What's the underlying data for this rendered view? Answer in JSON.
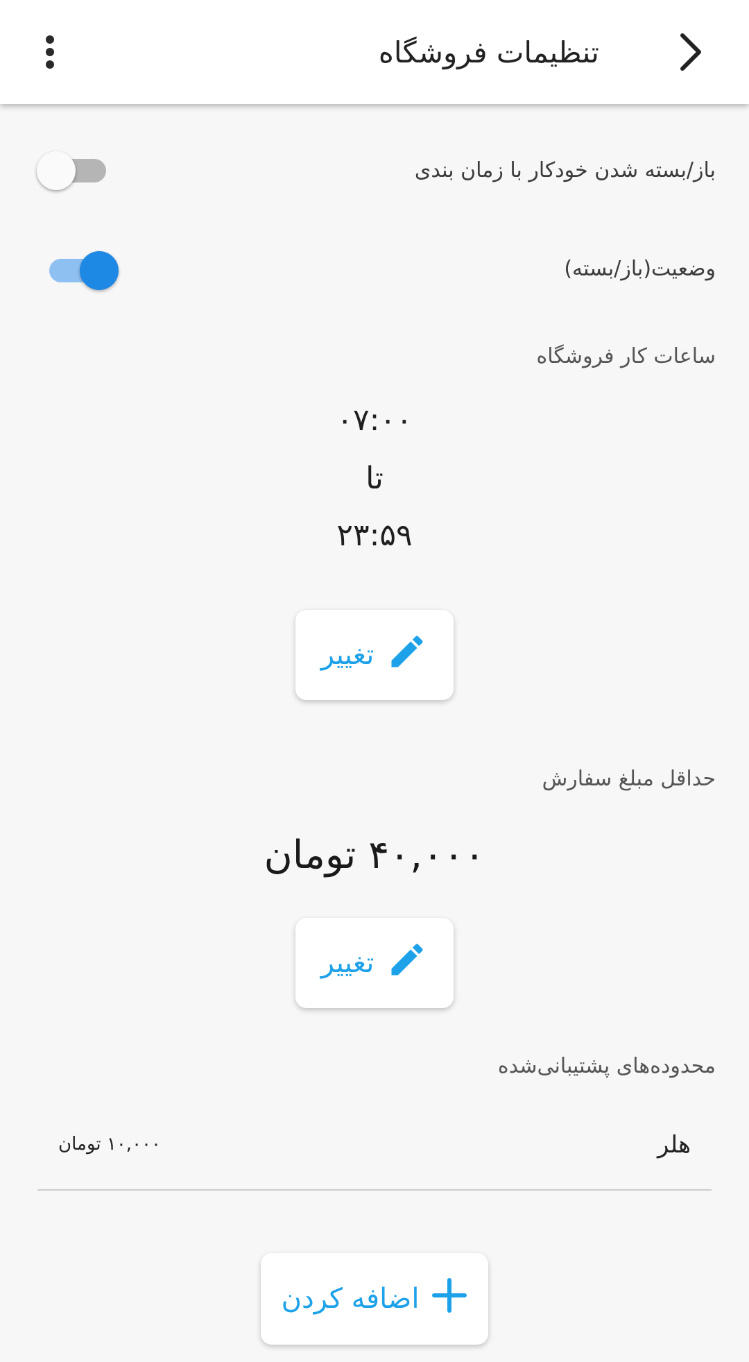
{
  "header": {
    "title": "تنظیمات فروشگاه",
    "back_icon": "chevron-right-icon",
    "menu_icon": "more-vert-icon"
  },
  "settings": {
    "auto_schedule": {
      "label": "باز/بسته شدن خودکار با زمان بندی",
      "enabled": false
    },
    "status": {
      "label": "وضعیت(باز/بسته)",
      "enabled": true
    }
  },
  "working_hours": {
    "label": "ساعات کار فروشگاه",
    "from": "۰۷:۰۰",
    "separator": "تا",
    "to": "۲۳:۵۹",
    "change_label": "تغییر"
  },
  "min_order": {
    "label": "حداقل مبلغ سفارش",
    "amount": "۴۰,۰۰۰ تومان",
    "change_label": "تغییر"
  },
  "regions": {
    "label": "محدوده‌های پشتیبانی‌شده",
    "items": [
      {
        "name": "هلر",
        "price": "۱۰,۰۰۰ تومان"
      }
    ],
    "add_label": "اضافه کردن"
  },
  "colors": {
    "accent": "#1da1e8",
    "switch_on": "#1e88e5",
    "switch_on_track": "#8fc0f2",
    "background": "#f7f7f7"
  }
}
